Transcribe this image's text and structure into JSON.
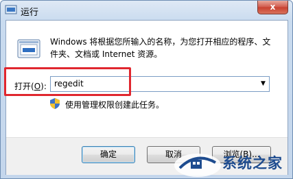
{
  "window": {
    "title": "运行",
    "close_glyph": "x"
  },
  "description": "Windows 将根据您所输入的名称，为您打开相应的程序、文件夹、文档或 Internet 资源。",
  "open": {
    "label_prefix": "打开(",
    "accel": "O",
    "label_suffix": "):",
    "value": "regedit"
  },
  "admin_note": "使用管理权限创建此任务。",
  "buttons": {
    "ok": "确定",
    "cancel": "取消",
    "browse": "浏览(B)..."
  },
  "watermark": {
    "text": "系统之家"
  },
  "icons": [
    "run-icon",
    "shield-icon",
    "dropdown-arrow-icon",
    "close-icon"
  ],
  "colors": {
    "highlight_box": "#e0262e",
    "close_button": "#c8402f",
    "watermark": "#1e4c8f"
  }
}
